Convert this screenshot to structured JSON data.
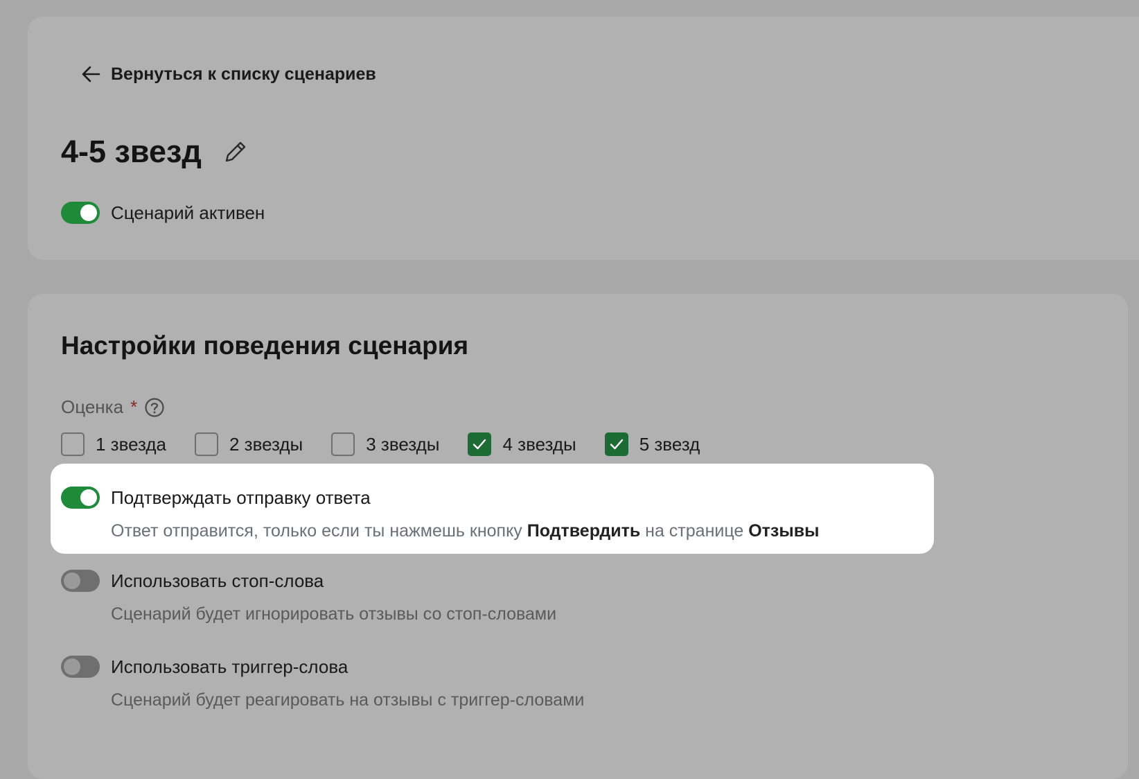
{
  "header": {
    "back_label": "Вернуться к списку сценариев",
    "title": "4-5 звезд",
    "active_label": "Сценарий активен",
    "active_on": true
  },
  "settings": {
    "section_title": "Настройки поведения сценария",
    "rating_label": "Оценка",
    "rating_required_mark": "*",
    "ratings": [
      {
        "label": "1 звезда",
        "checked": false
      },
      {
        "label": "2 звезды",
        "checked": false
      },
      {
        "label": "3 звезды",
        "checked": false
      },
      {
        "label": "4 звезды",
        "checked": true
      },
      {
        "label": "5 звезд",
        "checked": true
      }
    ],
    "options": [
      {
        "label": "Подтверждать отправку ответа",
        "on": true,
        "desc_parts": [
          "Ответ отправится, только если ты нажмешь кнопку ",
          "Подтвердить",
          " на странице ",
          "Отзывы"
        ]
      },
      {
        "label": "Использовать стоп-слова",
        "on": false,
        "desc": "Сценарий будет игнорировать отзывы со стоп-словами"
      },
      {
        "label": "Использовать триггер-слова",
        "on": false,
        "desc": "Сценарий будет реагировать на отзывы с триггер-словами"
      }
    ]
  },
  "colors": {
    "toggle_on": "#1e8a3a",
    "checkbox_checked": "#1d6b34",
    "required_mark": "#8b2a24"
  },
  "icons": {
    "back": "arrow-left-icon",
    "edit": "pencil-icon",
    "help": "question-circle-icon",
    "check": "checkmark-icon"
  }
}
